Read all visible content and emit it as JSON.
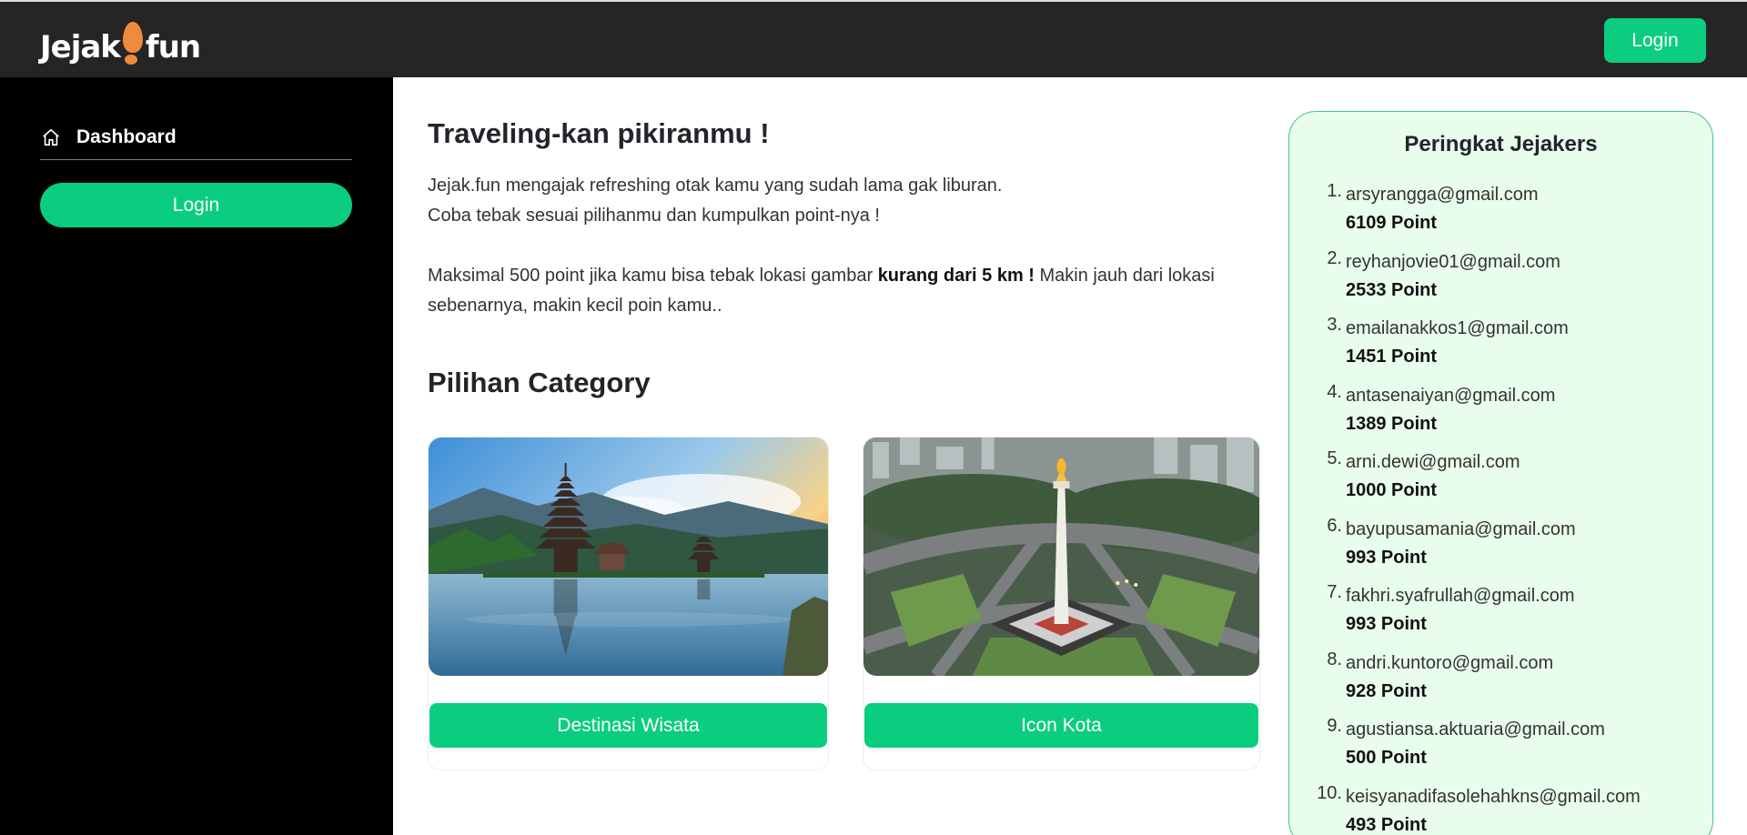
{
  "header": {
    "logo_left": "Jejak",
    "logo_right": "fun",
    "login_label": "Login"
  },
  "sidebar": {
    "dashboard_label": "Dashboard",
    "login_label": "Login"
  },
  "main": {
    "headline": "Traveling-kan pikiranmu !",
    "intro_line1": "Jejak.fun mengajak refreshing otak kamu yang sudah lama gak liburan.",
    "intro_line2": "Coba tebak sesuai pilihanmu dan kumpulkan point-nya !",
    "intro_line3_a": "Maksimal 500 point jika kamu bisa tebak lokasi gambar ",
    "intro_line3_bold": "kurang dari 5 km !",
    "intro_line3_b": " Makin jauh dari lokasi sebenarnya, makin kecil poin kamu..",
    "category_title": "Pilihan Category",
    "categories": [
      {
        "label": "Destinasi Wisata",
        "image": "bali-temple-lake-image"
      },
      {
        "label": "Icon Kota",
        "image": "monas-monument-image"
      }
    ]
  },
  "leaderboard": {
    "title": "Peringkat Jejakers",
    "entries": [
      {
        "rank": "1.",
        "email": "arsyrangga@gmail.com",
        "points": "6109 Point"
      },
      {
        "rank": "2.",
        "email": "reyhanjovie01@gmail.com",
        "points": "2533 Point"
      },
      {
        "rank": "3.",
        "email": "emailanakkos1@gmail.com",
        "points": "1451 Point"
      },
      {
        "rank": "4.",
        "email": "antasenaiyan@gmail.com",
        "points": "1389 Point"
      },
      {
        "rank": "5.",
        "email": "arni.dewi@gmail.com",
        "points": "1000 Point"
      },
      {
        "rank": "6.",
        "email": "bayupusamania@gmail.com",
        "points": "993 Point"
      },
      {
        "rank": "7.",
        "email": "fakhri.syafrullah@gmail.com",
        "points": "993 Point"
      },
      {
        "rank": "8.",
        "email": "andri.kuntoro@gmail.com",
        "points": "928 Point"
      },
      {
        "rank": "9.",
        "email": "agustiansa.aktuaria@gmail.com",
        "points": "500 Point"
      },
      {
        "rank": "10.",
        "email": "keisyanadifasolehahkns@gmail.com",
        "points": "493 Point"
      }
    ]
  },
  "colors": {
    "accent": "#0bcd7f",
    "topbar": "#252525",
    "sidebar": "#000000",
    "leaderboard_bg": "#e9fdec",
    "logo_foot": "#f08a3c"
  }
}
